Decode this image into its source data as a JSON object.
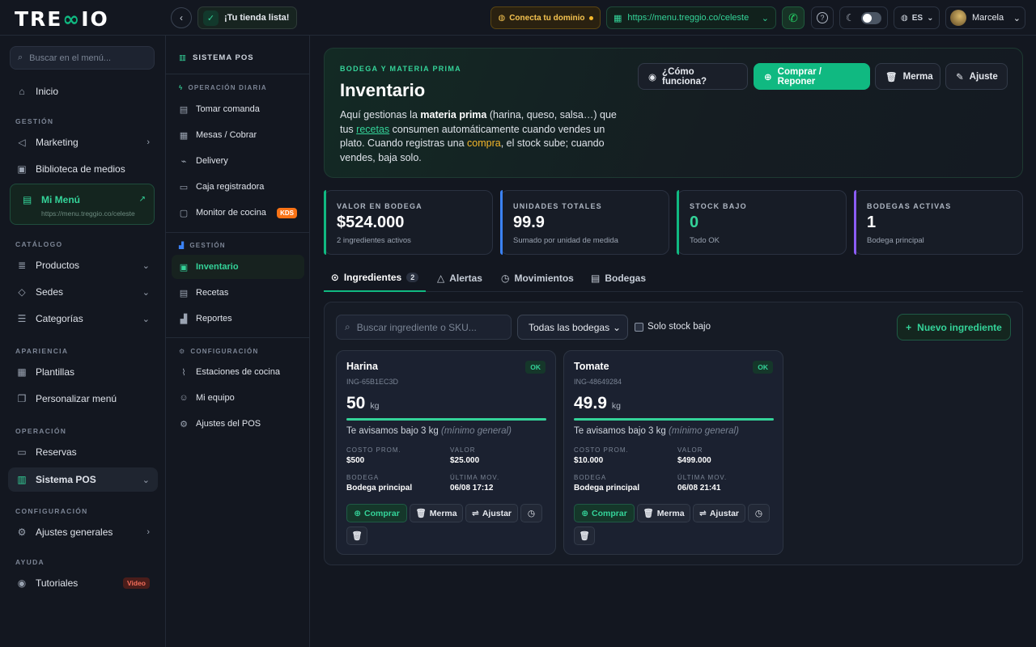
{
  "brand": {
    "pre": "TRE",
    "mid": "∞",
    "post": "IO"
  },
  "topbar": {
    "ready_label": "¡Tu tienda lista!",
    "domain_label": "Conecta tu dominio",
    "url": "https://menu.treggio.co/celeste",
    "lang": "ES",
    "user": "Marcela"
  },
  "sidebar": {
    "search_placeholder": "Buscar en el menú...",
    "home": "Inicio",
    "sec_gestion": "GESTIÓN",
    "marketing": "Marketing",
    "media": "Biblioteca de medios",
    "mimenu": {
      "title": "Mi Menú",
      "url": "https://menu.treggio.co/celeste"
    },
    "sec_catalogo": "CATÁLOGO",
    "productos": "Productos",
    "sedes": "Sedes",
    "categorias": "Categorías",
    "sec_apariencia": "APARIENCIA",
    "plantillas": "Plantillas",
    "personalizar": "Personalizar menú",
    "sec_operacion": "OPERACIÓN",
    "reservas": "Reservas",
    "pos": "Sistema POS",
    "sec_config": "CONFIGURACIÓN",
    "ajustes": "Ajustes generales",
    "sec_ayuda": "AYUDA",
    "tutoriales": "Tutoriales",
    "video_badge": "Video"
  },
  "pos_menu": {
    "title": "SISTEMA POS",
    "sec_diaria": "OPERACIÓN DIARIA",
    "comanda": "Tomar comanda",
    "mesas": "Mesas / Cobrar",
    "delivery": "Delivery",
    "caja": "Caja registradora",
    "monitor": "Monitor de cocina",
    "kds": "KDS",
    "sec_gestion": "GESTIÓN",
    "inventario": "Inventario",
    "recetas": "Recetas",
    "reportes": "Reportes",
    "sec_config": "CONFIGURACIÓN",
    "estaciones": "Estaciones de cocina",
    "equipo": "Mi equipo",
    "ajustes_pos": "Ajustes del POS"
  },
  "hero": {
    "eyebrow": "BODEGA Y MATERIA PRIMA",
    "title": "Inventario",
    "p1": "Aquí gestionas la ",
    "p_bold": "materia prima",
    "p2": " (harina, queso, salsa…) que tus ",
    "p_link": "recetas",
    "p3": " consumen automáticamente cuando vendes un plato. Cuando registras una ",
    "p_compra": "compra",
    "p4": ", el stock sube; cuando vendes, baja solo.",
    "btn_how": "¿Cómo funciona?",
    "btn_buy": "Comprar / Reponer",
    "btn_waste": "Merma",
    "btn_adjust": "Ajuste"
  },
  "stats": [
    {
      "label": "VALOR EN BODEGA",
      "value": "$524.000",
      "sub": "2 ingredientes activos",
      "color": "#10b981"
    },
    {
      "label": "UNIDADES TOTALES",
      "value": "99.9",
      "sub": "Sumado por unidad de medida",
      "color": "#3b82f6"
    },
    {
      "label": "STOCK BAJO",
      "value": "0",
      "sub": "Todo OK",
      "color": "#10b981"
    },
    {
      "label": "BODEGAS ACTIVAS",
      "value": "1",
      "sub": "Bodega principal",
      "color": "#8b5cf6"
    }
  ],
  "tabs": {
    "ingredientes": "Ingredientes",
    "count": "2",
    "alertas": "Alertas",
    "movimientos": "Movimientos",
    "bodegas": "Bodegas"
  },
  "filters": {
    "search_placeholder": "Buscar ingrediente o SKU...",
    "select_value": "Todas las bodegas",
    "low_stock": "Solo stock bajo",
    "new_button": "Nuevo ingrediente"
  },
  "cards": [
    {
      "name": "Harina",
      "status": "OK",
      "sku": "ING-65B1EC3D",
      "qty": "50",
      "unit": "kg",
      "level": 1.0,
      "warn": "Te avisamos bajo 3 kg",
      "warn_note": "(mínimo general)",
      "cost_label": "COSTO PROM.",
      "cost": "$500",
      "value_label": "VALOR",
      "value": "$25.000",
      "store_label": "BODEGA",
      "store": "Bodega principal",
      "last_label": "ÚLTIMA MOV.",
      "last": "06/08 17:12",
      "buy": "Comprar",
      "waste": "Merma",
      "adjust": "Ajustar"
    },
    {
      "name": "Tomate",
      "status": "OK",
      "sku": "ING-48649284",
      "qty": "49.9",
      "unit": "kg",
      "level": 1.0,
      "warn": "Te avisamos bajo 3 kg",
      "warn_note": "(mínimo general)",
      "cost_label": "COSTO PROM.",
      "cost": "$10.000",
      "value_label": "VALOR",
      "value": "$499.000",
      "store_label": "BODEGA",
      "store": "Bodega principal",
      "last_label": "ÚLTIMA MOV.",
      "last": "06/08 21:41",
      "buy": "Comprar",
      "waste": "Merma",
      "adjust": "Ajustar"
    }
  ]
}
